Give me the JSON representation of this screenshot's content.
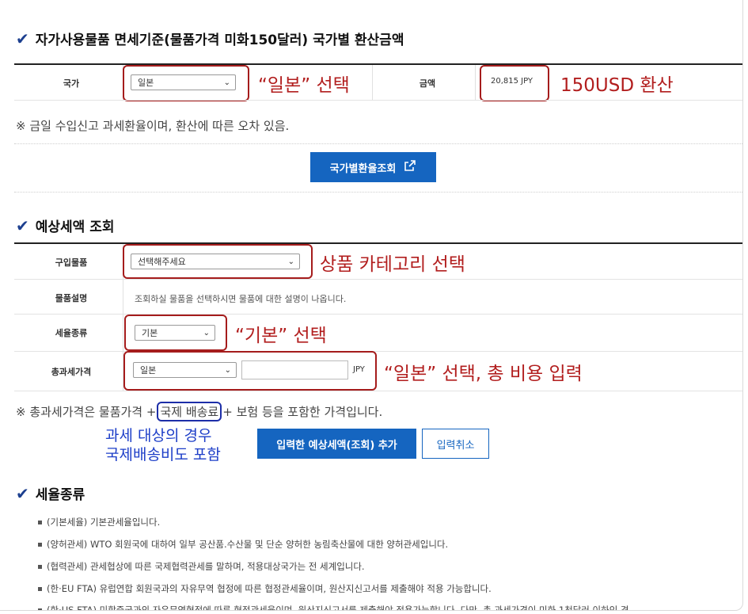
{
  "section1": {
    "title": "자가사용물품 면세기준(물품가격 미화150달러) 국가별 환산금액",
    "country_label": "국가",
    "country_value": "일본",
    "amount_label": "금액",
    "amount_value": "20,815 JPY",
    "annot_country": "“일본” 선택",
    "annot_amount": "150USD 환산",
    "note": "※ 금일 수입신고 과세환율이며, 환산에 따른 오차 있음.",
    "lookup_button": "국가별환율조회"
  },
  "section2": {
    "title": "예상세액 조회",
    "rows": {
      "item_label": "구입물품",
      "item_value": "선택해주세요",
      "item_annot": "상품 카테고리 선택",
      "desc_label": "물품설명",
      "desc_value": "조회하실 물품을 선택하시면 물품에 대한 설명이 나옵니다.",
      "tax_label": "세율종류",
      "tax_value": "기본",
      "tax_annot": "“기본” 선택",
      "total_label": "총과세가격",
      "total_country": "일본",
      "total_unit": "JPY",
      "total_annot": "“일본” 선택, 총 비용 입력"
    },
    "note_prefix": "※ 총과세가격은 물품가격 +",
    "note_highlight": "국제 배송료",
    "note_suffix": "+ 보험 등을 포함한 가격입니다.",
    "blue_annot_line1": "과세 대상의 경우",
    "blue_annot_line2": "국제배송비도 포함",
    "add_button": "입력한 예상세액(조회) 추가",
    "cancel_button": "입력취소"
  },
  "section3": {
    "title": "세율종류",
    "bullets": [
      "(기본세율) 기본관세율입니다.",
      "(양허관세) WTO 회원국에 대하여 일부 공산품.수산물 및 단순 양허한 농림축산물에 대한 양허관세입니다.",
      "(협력관세) 관세협상에 따른 국제협력관세를 말하며, 적용대상국가는 전 세계입니다.",
      "(한·EU FTA) 유럽연합 회원국과의 자유무역 협정에 따른 협정관세율이며, 원산지신고서를 제출해야 적용 가능합니다.",
      "(한·US FTA) 미합중국과의 자유무역협정에 따른 협정관세율이며, 원산지신고서를 제출해야 적용가능합니다. 다만, 총 과세가격이 미화 1천달러 이하인 경"
    ]
  },
  "colors": {
    "accent_blue": "#1565c0",
    "annot_red": "#b21e1e",
    "annot_blue": "#1d3ec8"
  }
}
